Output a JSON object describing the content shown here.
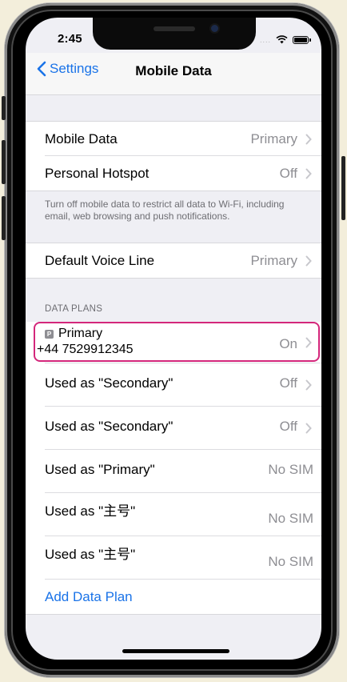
{
  "status_bar": {
    "time": "2:45",
    "signal": "...."
  },
  "nav": {
    "back_label": "Settings",
    "title": "Mobile Data"
  },
  "section1": {
    "rows": [
      {
        "label": "Mobile Data",
        "value": "Primary"
      },
      {
        "label": "Personal Hotspot",
        "value": "Off"
      }
    ],
    "note": "Turn off mobile data to restrict all data to Wi-Fi, including email, web browsing and push notifications."
  },
  "section2": {
    "rows": [
      {
        "label": "Default Voice Line",
        "value": "Primary"
      }
    ]
  },
  "data_plans": {
    "header": "DATA PLANS",
    "primary": {
      "badge": "P",
      "label": "Primary",
      "number": "+44 7529912345",
      "value": "On"
    },
    "rows": [
      {
        "label": "Used as \"Secondary\"",
        "value": "Off"
      },
      {
        "label": "Used as \"Secondary\"",
        "value": "Off"
      },
      {
        "label": "Used as \"Primary\"",
        "value": "No SIM"
      },
      {
        "label": "Used as \"主号\"",
        "value": "No SIM"
      },
      {
        "label": "Used as \"主号\"",
        "value": "No SIM"
      }
    ],
    "add_label": "Add Data Plan"
  },
  "colors": {
    "accent": "#1a73e8",
    "highlight": "#d4277b",
    "background": "#efeff4"
  }
}
